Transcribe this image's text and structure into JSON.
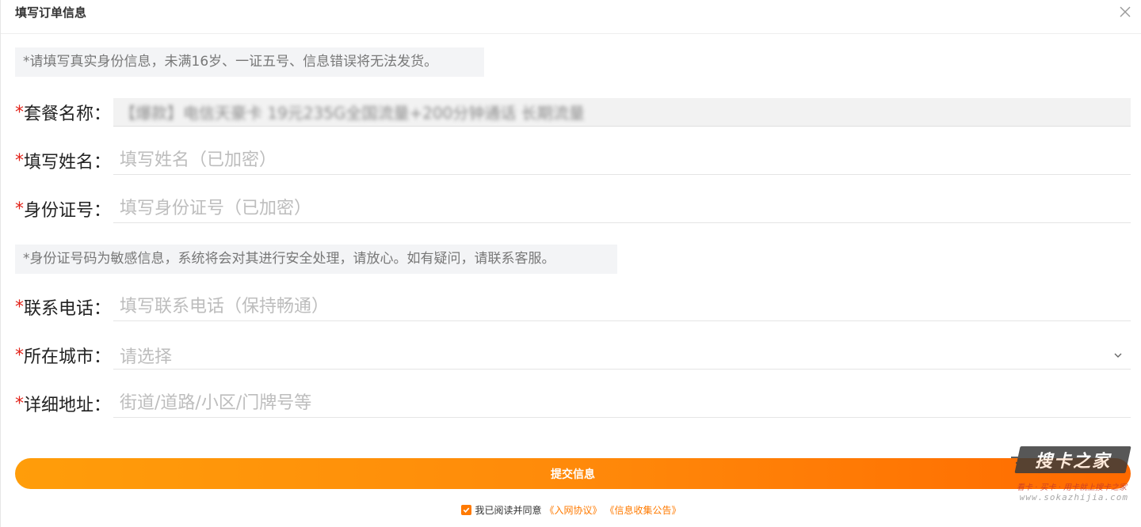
{
  "dialog": {
    "title": "填写订单信息",
    "close_icon": "close-icon"
  },
  "notice_top": "*请填写真实身份信息，未满16岁、一证五号、信息错误将无法发货。",
  "notice_mid": "*身份证号码为敏感信息，系统将会对其进行安全处理，请放心。如有疑问，请联系客服。",
  "required_mark": "*",
  "fields": {
    "package": {
      "label": "套餐名称：",
      "value": "【爆款】电信天豪卡 19元235G全国流量+200分钟通话 长期流量"
    },
    "name": {
      "label": "填写姓名：",
      "placeholder": "填写姓名（已加密）"
    },
    "id_number": {
      "label": "身份证号：",
      "placeholder": "填写身份证号（已加密）"
    },
    "phone": {
      "label": "联系电话：",
      "placeholder": "填写联系电话（保持畅通）"
    },
    "city": {
      "label": "所在城市：",
      "placeholder": "请选择"
    },
    "address": {
      "label": "详细地址：",
      "placeholder": "街道/道路/小区/门牌号等"
    }
  },
  "submit_label": "提交信息",
  "agreement": {
    "checked": true,
    "text": "我已阅读并同意",
    "link1": "《入网协议》",
    "link2": "《信息收集公告》"
  },
  "watermark": {
    "logo": "搜卡之家",
    "slogan": "看卡 · 买卡 · 用卡就上搜卡之家",
    "url": "www.sokazhijia.com"
  },
  "colors": {
    "accent": "#ff7a00",
    "required": "#e2231a",
    "notice_bg": "#f3f4f6"
  }
}
